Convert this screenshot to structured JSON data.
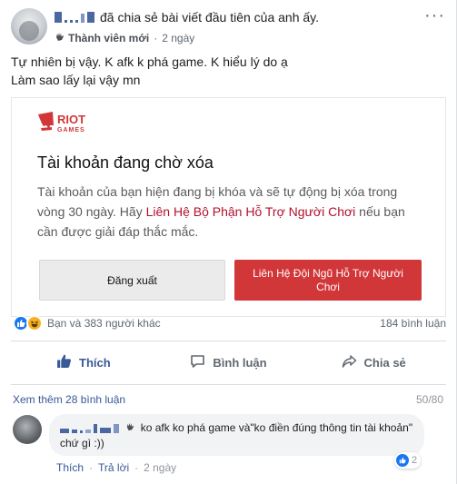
{
  "header": {
    "shared_text": "đã chia sẻ bài viết đầu tiên của anh ấy.",
    "badge": "Thành viên mới",
    "time": "2 ngày",
    "separator": "·"
  },
  "post": {
    "line1": "Tự nhiên bị vậy. K afk k phá game. K hiểu lý do ạ",
    "line2": "Làm sao lấy lại vậy mn"
  },
  "riot_card": {
    "logo_line1": "RIOT",
    "logo_line2": "GAMES",
    "title": "Tài khoản đang chờ xóa",
    "desc_part1": "Tài khoản của bạn hiện đang bị khóa và sẽ tự động bị xóa trong vòng 30 ngày. Hãy ",
    "desc_link": "Liên Hệ Bộ Phận Hỗ Trợ Người Chơi",
    "desc_part2": " nếu bạn cần được giải đáp thắc mắc.",
    "logout_label": "Đăng xuất",
    "support_label": "Liên Hệ Đội Ngũ Hỗ Trợ Người Chơi",
    "accent": "#d13639"
  },
  "reactions": {
    "summary": "Bạn và 383 người khác",
    "comment_count": "184 bình luận"
  },
  "actions": {
    "like": "Thích",
    "comment": "Bình luận",
    "share": "Chia sẻ"
  },
  "comments": {
    "view_more": "Xem thêm 28 bình luận",
    "page_indicator": "50/80",
    "items": [
      {
        "text": "ko afk ko phá game và\"ko điền đúng thông tin tài khoản\" chứ gì :))",
        "like_action": "Thích",
        "reply_action": "Trả lời",
        "time": "2 ngày",
        "reaction_count": "2"
      }
    ]
  },
  "colors": {
    "link": "#385898",
    "facebook_blue": "#1877f2",
    "muted": "#606770"
  }
}
